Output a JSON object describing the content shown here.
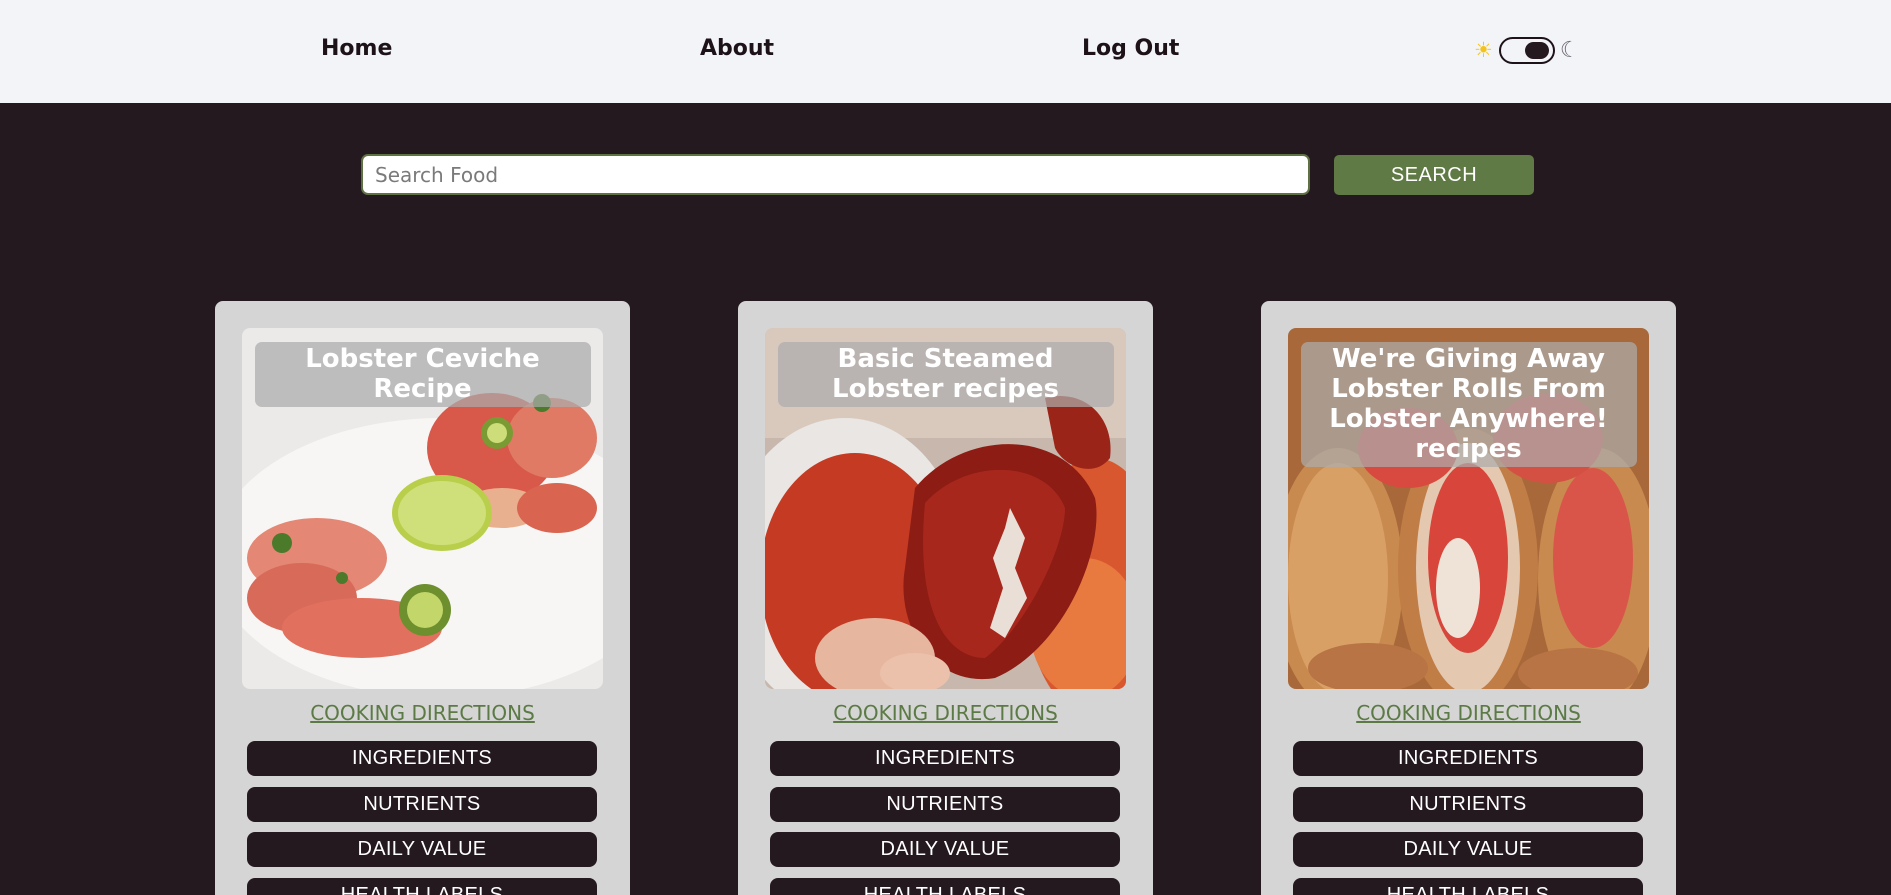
{
  "nav": {
    "home": "Home",
    "about": "About",
    "logout": "Log Out",
    "theme": {
      "light_icon": "sun-icon",
      "dark_icon": "moon-icon",
      "sun_glyph": "☀",
      "moon_glyph": "☾",
      "toggle_state": "dark"
    }
  },
  "search": {
    "placeholder": "Search Food",
    "value": "",
    "button_label": "SEARCH"
  },
  "cards": [
    {
      "title": "Lobster Ceviche Recipe",
      "directions_label": "COOKING DIRECTIONS",
      "buttons": [
        "INGREDIENTS",
        "NUTRIENTS",
        "DAILY VALUE",
        "HEALTH LABELS"
      ]
    },
    {
      "title": "Basic Steamed Lobster recipes",
      "directions_label": "COOKING DIRECTIONS",
      "buttons": [
        "INGREDIENTS",
        "NUTRIENTS",
        "DAILY VALUE",
        "HEALTH LABELS"
      ]
    },
    {
      "title": "We're Giving Away Lobster Rolls From Lobster Anywhere! recipes",
      "directions_label": "COOKING DIRECTIONS",
      "buttons": [
        "INGREDIENTS",
        "NUTRIENTS",
        "DAILY VALUE",
        "HEALTH LABELS"
      ]
    }
  ],
  "colors": {
    "background": "#251920",
    "nav_background": "#f3f4f8",
    "accent_green": "#5f7a44",
    "card_background": "#d5d5d5"
  }
}
